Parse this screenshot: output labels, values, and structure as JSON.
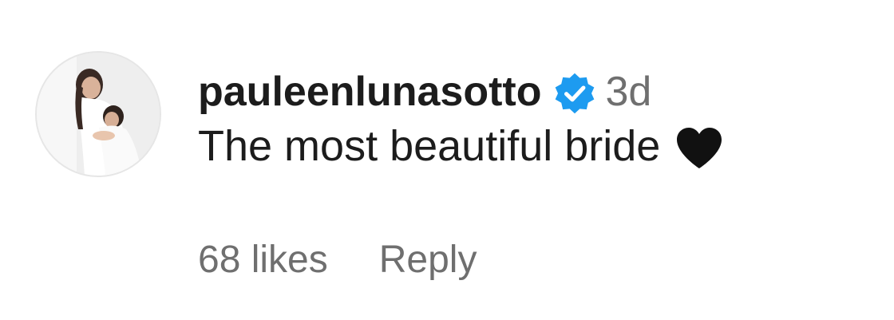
{
  "comment": {
    "username": "pauleenlunasotto",
    "verified_icon": "verified-badge",
    "timestamp": "3d",
    "text": "The most beautiful bride",
    "emoji_icon": "black-heart",
    "likes_label": "68 likes",
    "reply_label": "Reply"
  },
  "colors": {
    "verified_blue": "#1d9bf0",
    "secondary_text": "#6f6f6f",
    "primary_text": "#1c1c1c"
  }
}
